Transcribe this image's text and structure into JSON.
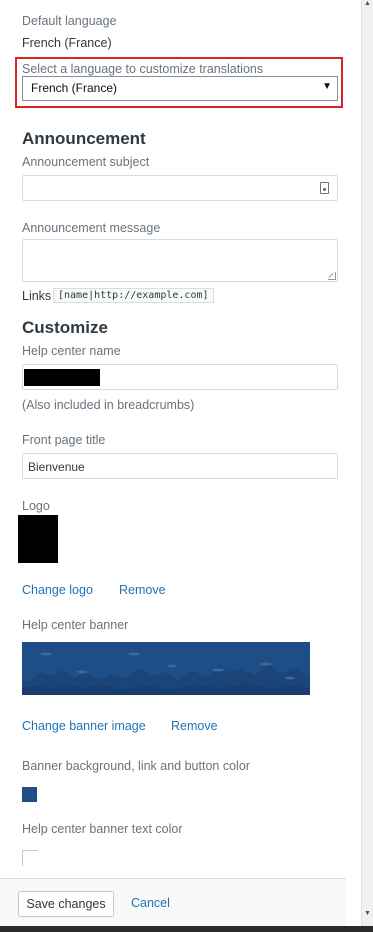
{
  "default_language": {
    "label": "Default language",
    "value": "French (France)"
  },
  "language_select": {
    "label": "Select a language to customize translations",
    "selected": "French (France)",
    "arrow": "▼"
  },
  "announcement": {
    "heading": "Announcement",
    "subject_label": "Announcement subject",
    "subject_value": "",
    "message_label": "Announcement message",
    "message_value": "",
    "links_label": "Links",
    "links_example": "[name|http://example.com]"
  },
  "customize": {
    "heading": "Customize",
    "help_center_name_label": "Help center name",
    "help_center_name_hint": "(Also included in breadcrumbs)",
    "front_page_title_label": "Front page title",
    "front_page_title_value": "Bienvenue",
    "logo_label": "Logo",
    "change_logo": "Change logo",
    "remove_logo": "Remove",
    "banner_label": "Help center banner",
    "change_banner": "Change banner image",
    "remove_banner": "Remove",
    "banner_color_label": "Banner background, link and button color",
    "banner_color": "#1f4d86",
    "banner_text_color_label": "Help center banner text color",
    "banner_text_color": "#ffffff"
  },
  "footer": {
    "save": "Save changes",
    "cancel": "Cancel"
  },
  "colors": {
    "accent": "#1f73b7",
    "highlight": "#d9252a",
    "banner": "#1f4d86"
  }
}
